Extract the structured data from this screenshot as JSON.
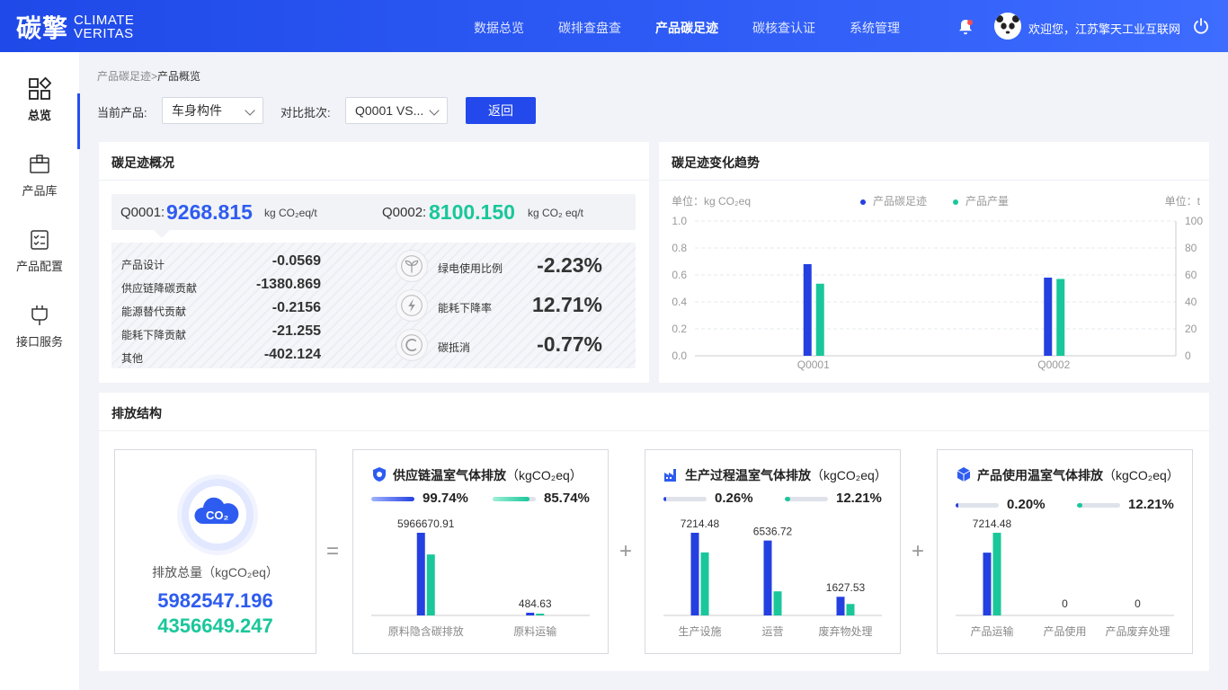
{
  "header": {
    "logo_cn": "碳擎",
    "logo_en_line1": "CLIMATE",
    "logo_en_line2": "VERITAS",
    "nav": [
      "数据总览",
      "碳排查盘查",
      "产品碳足迹",
      "碳核查认证",
      "系统管理"
    ],
    "nav_active_index": 2,
    "welcome": "欢迎您，江苏擎天工业互联网"
  },
  "sidebar": {
    "items": [
      {
        "label": "总览",
        "icon": "grid-apps-icon"
      },
      {
        "label": "产品库",
        "icon": "product-box-icon"
      },
      {
        "label": "产品配置",
        "icon": "checklist-icon"
      },
      {
        "label": "接口服务",
        "icon": "plug-icon"
      }
    ]
  },
  "breadcrumb": {
    "parent": "产品碳足迹",
    "sep": ">",
    "current": "产品概览"
  },
  "filters": {
    "product_label": "当前产品:",
    "product_value": "车身构件",
    "batch_label": "对比批次:",
    "batch_value": "Q0001 VS...",
    "back_button": "返回"
  },
  "overview": {
    "title": "碳足迹概况",
    "q1_label": "Q0001:",
    "q1_value": "9268.815",
    "q1_unit": "kg CO₂eq/t",
    "q2_label": "Q0002:",
    "q2_value": "8100.150",
    "q2_unit": "kg CO₂ eq/t",
    "stats": [
      {
        "label": "产品设计",
        "value": "-0.0569"
      },
      {
        "label": "供应链降碳贡献",
        "value": "-1380.869"
      },
      {
        "label": "能源替代贡献",
        "value": "-0.2156"
      },
      {
        "label": "能耗下降贡献",
        "value": "-21.255"
      },
      {
        "label": "其他",
        "value": "-402.124"
      }
    ],
    "kpis": [
      {
        "label": "绿电使用比例",
        "value": "-2.23%",
        "icon": "seedling-icon"
      },
      {
        "label": "能耗下降率",
        "value": "12.71%",
        "icon": "lightning-icon"
      },
      {
        "label": "碳抵消",
        "value": "-0.77%",
        "icon": "carbon-c-icon"
      }
    ]
  },
  "trend": {
    "title": "碳足迹变化趋势",
    "left_unit": "单位：kg CO₂eq",
    "right_unit": "单位：t",
    "legend": [
      "产品碳足迹",
      "产品产量"
    ]
  },
  "chart_data": {
    "type": "bar",
    "title": "碳足迹变化趋势",
    "categories": [
      "Q0001",
      "Q0002"
    ],
    "series": [
      {
        "name": "产品碳足迹",
        "values": [
          0.68,
          0.58
        ],
        "axis": "left",
        "color": "#2440e0"
      },
      {
        "name": "产品产量",
        "values": [
          53.5,
          57
        ],
        "axis": "right",
        "color": "#19c79a"
      }
    ],
    "y_left": {
      "ticks": [
        "1.0",
        "0.8",
        "0.6",
        "0.4",
        "0.2",
        "0.0"
      ],
      "range": [
        0,
        1.0
      ]
    },
    "y_right": {
      "ticks": [
        "100",
        "80",
        "60",
        "40",
        "20",
        "0"
      ],
      "range": [
        0,
        100
      ]
    },
    "grid": true,
    "legend_position": "top"
  },
  "structure": {
    "title": "排放结构",
    "total_label": "排放总量（kgCO₂eq）",
    "total_q1": "5982547.196",
    "total_q2": "4356649.247",
    "co2_badge": "CO₂",
    "eq_sign": "=",
    "plus_sign": "+",
    "cards": [
      {
        "title": "供应链温室气体排放",
        "unit": "（kgCO₂eq）",
        "icon": "shield-leaf-icon",
        "pct1": "99.74%",
        "pct1_num": 0.9974,
        "pct2": "85.74%",
        "pct2_num": 0.8574,
        "bars": [
          {
            "label": "原料隐含碳排放",
            "v1": 5966670.91,
            "v2": 4400000,
            "v_label": "5966670.91"
          },
          {
            "label": "原料运输",
            "v1": 484.63,
            "v2": 300,
            "v_label": "484.63"
          }
        ]
      },
      {
        "title": "生产过程温室气体排放",
        "unit": "（kgCO₂eq）",
        "icon": "factory-icon",
        "pct1": "0.26%",
        "pct1_num": 0.0026,
        "pct2": "12.21%",
        "pct2_num": 0.1221,
        "bars": [
          {
            "label": "生产设施",
            "v1": 7214.48,
            "v2": 5500,
            "v_label": "7214.48"
          },
          {
            "label": "运营",
            "v1": 6536.72,
            "v2": 2100,
            "v_label": "6536.72"
          },
          {
            "label": "废弃物处理",
            "v1": 1627.53,
            "v2": 1000,
            "v_label": "1627.53"
          }
        ]
      },
      {
        "title": "产品使用温室气体排放",
        "unit": "（kgCO₂eq）",
        "icon": "cube-icon",
        "pct1": "0.20%",
        "pct1_num": 0.002,
        "pct2": "12.21%",
        "pct2_num": 0.1221,
        "bars": [
          {
            "label": "产品运输",
            "v1": 7214.48,
            "v2": 9500,
            "v_label": "7214.48"
          },
          {
            "label": "产品使用",
            "v1": 0,
            "v2": 0,
            "v_label": "0"
          },
          {
            "label": "产品废弃处理",
            "v1": 0,
            "v2": 0,
            "v_label": "0"
          }
        ]
      }
    ]
  },
  "colors": {
    "primary": "#2348ec",
    "q1_blue": "#2e5cf0",
    "q2_green": "#19c79a",
    "bar_blue": "#2440e0",
    "bar_green": "#19c79a"
  }
}
